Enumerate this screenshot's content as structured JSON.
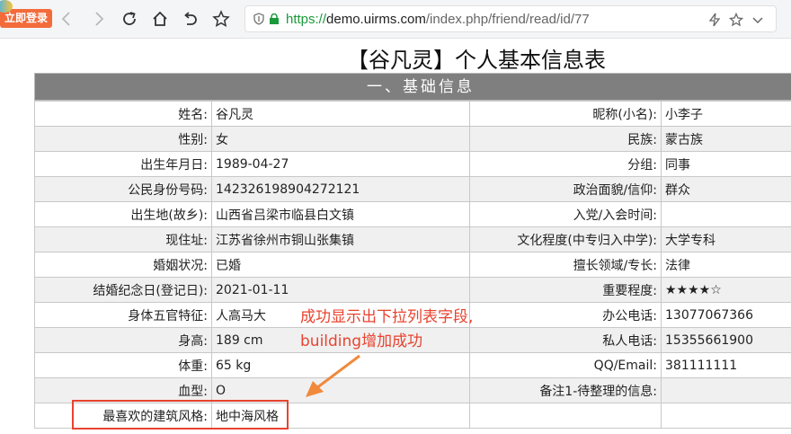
{
  "browser": {
    "login_badge": "立即登录",
    "url_scheme": "https://",
    "url_host": "demo.uirms.com",
    "url_path": "/index.php/friend/read/id/77"
  },
  "page": {
    "title": "【谷凡灵】个人基本信息表",
    "section_title": "一、基础信息"
  },
  "rows": [
    {
      "l1": "姓名:",
      "v1": "谷凡灵",
      "l2": "昵称(小名):",
      "v2": "小李子"
    },
    {
      "l1": "性别:",
      "v1": "女",
      "l2": "民族:",
      "v2": "蒙古族"
    },
    {
      "l1": "出生年月日:",
      "v1": "1989-04-27",
      "l2": "分组:",
      "v2": "同事"
    },
    {
      "l1": "公民身份号码:",
      "v1": "142326198904272121",
      "l2": "政治面貌/信仰:",
      "v2": "群众"
    },
    {
      "l1": "出生地(故乡):",
      "v1": "山西省吕梁市临县白文镇",
      "l2": "入党/入会时间:",
      "v2": ""
    },
    {
      "l1": "现住址:",
      "v1": "江苏省徐州市铜山张集镇",
      "l2": "文化程度(中专归入中学):",
      "v2": "大学专科"
    },
    {
      "l1": "婚姻状况:",
      "v1": "已婚",
      "l2": "擅长领域/专长:",
      "v2": "法律"
    },
    {
      "l1": "结婚纪念日(登记日):",
      "v1": "2021-01-11",
      "l2": "重要程度:",
      "v2": "★★★★☆"
    },
    {
      "l1": "身体五官特征:",
      "v1": "人高马大",
      "l2": "办公电话:",
      "v2": "13077067366"
    },
    {
      "l1": "身高:",
      "v1": "189 cm",
      "l2": "私人电话:",
      "v2": "15355661900"
    },
    {
      "l1": "体重:",
      "v1": "65 kg",
      "l2": "QQ/Email:",
      "v2": "381111111"
    },
    {
      "l1": "血型:",
      "v1": "O",
      "l2": "备注1-待整理的信息:",
      "v2": ""
    },
    {
      "l1": "最喜欢的建筑风格:",
      "v1": "地中海风格",
      "l2": "",
      "v2": ""
    }
  ],
  "annotation": {
    "line1": "成功显示出下拉列表字段,",
    "line2": "building增加成功"
  },
  "colors": {
    "section_bg": "#7f7f7f",
    "annotation": "#e8432f",
    "secure_green": "#1a9a3a"
  }
}
